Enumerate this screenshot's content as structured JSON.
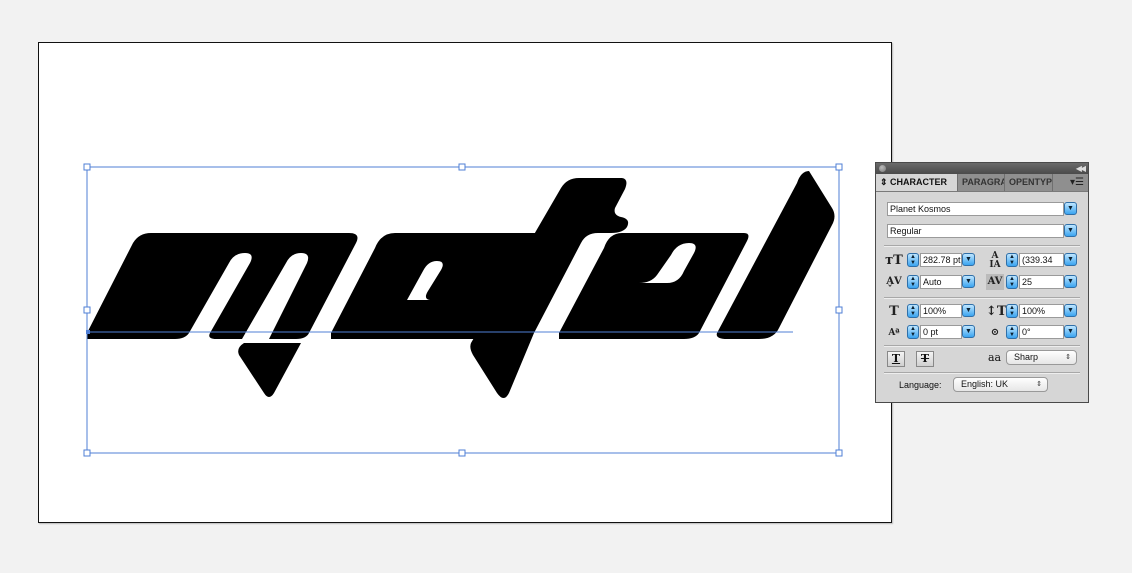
{
  "canvas": {
    "artwork_text": "metal",
    "selection_color": "#4f7fd6",
    "fill_color": "#000000"
  },
  "panel": {
    "tabs": [
      {
        "label": "CHARACTER",
        "active": true
      },
      {
        "label": "PARAGRAPH",
        "active": false
      },
      {
        "label": "OPENTYPE",
        "active": false
      }
    ],
    "collapse_icon": "double-chevron-left",
    "menu_icon": "panel-menu",
    "font_family": "Planet Kosmos",
    "font_style": "Regular",
    "font_size": "282.78 pt",
    "leading": "(339.34",
    "kerning": "Auto",
    "tracking": "25",
    "vertical_scale": "100%",
    "horizontal_scale": "100%",
    "baseline_shift": "0 pt",
    "rotation": "0°",
    "underline_label": "T",
    "strikethrough_label": "T",
    "antialias_icon_label": "aa",
    "antialias": "Sharp",
    "language_label": "Language:",
    "language": "English: UK"
  }
}
